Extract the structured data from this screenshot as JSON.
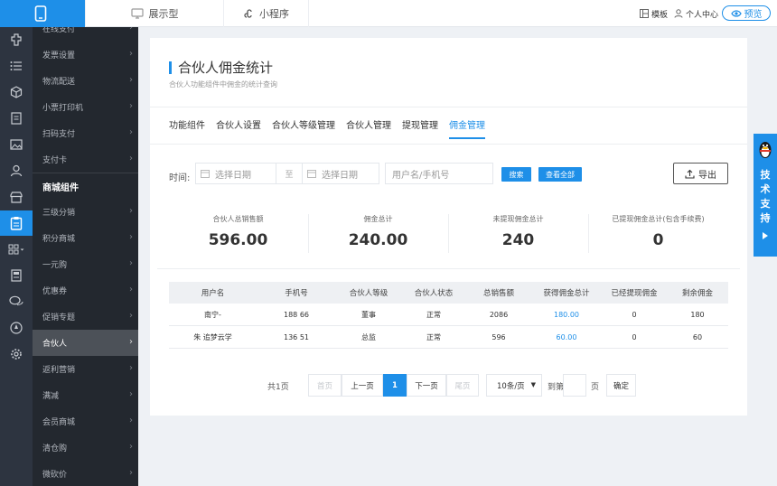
{
  "topbar": {
    "tab_show": "展示型",
    "tab_mini": "小程序",
    "template": "模板",
    "user_center": "个人中心",
    "preview": "预览"
  },
  "rail_icons": [
    "puzzle-icon",
    "list-icon",
    "cube-icon",
    "document-icon",
    "image-icon",
    "user-icon",
    "shop-icon",
    "clipboard-icon",
    "grid-icon",
    "report-icon",
    "chat-icon",
    "compass-icon",
    "gear-icon"
  ],
  "sidebar": {
    "items": [
      {
        "label": "在线支付",
        "group": false,
        "active": false
      },
      {
        "label": "发票设置",
        "group": false,
        "active": false
      },
      {
        "label": "物流配送",
        "group": false,
        "active": false
      },
      {
        "label": "小票打印机",
        "group": false,
        "active": false
      },
      {
        "label": "扫码支付",
        "group": false,
        "active": false
      },
      {
        "label": "支付卡",
        "group": false,
        "active": false
      },
      {
        "label": "商城组件",
        "group": true,
        "active": false
      },
      {
        "label": "三级分销",
        "group": false,
        "active": false
      },
      {
        "label": "积分商城",
        "group": false,
        "active": false
      },
      {
        "label": "一元购",
        "group": false,
        "active": false
      },
      {
        "label": "优惠券",
        "group": false,
        "active": false
      },
      {
        "label": "促销专题",
        "group": false,
        "active": false
      },
      {
        "label": "合伙人",
        "group": false,
        "active": true
      },
      {
        "label": "返利营销",
        "group": false,
        "active": false
      },
      {
        "label": "满减",
        "group": false,
        "active": false
      },
      {
        "label": "会员商城",
        "group": false,
        "active": false
      },
      {
        "label": "清仓购",
        "group": false,
        "active": false
      },
      {
        "label": "微砍价",
        "group": false,
        "active": false
      }
    ]
  },
  "page": {
    "title": "合伙人佣金统计",
    "subtitle": "合伙人功能组件中佣金的统计查询"
  },
  "tabs": [
    {
      "label": "功能组件",
      "active": false
    },
    {
      "label": "合伙人设置",
      "active": false
    },
    {
      "label": "合伙人等级管理",
      "active": false
    },
    {
      "label": "合伙人管理",
      "active": false
    },
    {
      "label": "提现管理",
      "active": false
    },
    {
      "label": "佣金管理",
      "active": true
    }
  ],
  "filters": {
    "time_label": "时间:",
    "start_placeholder": "选择日期",
    "separator": "至",
    "end_placeholder": "选择日期",
    "search_placeholder": "用户名/手机号",
    "search_button": "搜索",
    "view_all_button": "查看全部",
    "export_button": "导出"
  },
  "stats": [
    {
      "label": "合伙人总销售额",
      "value": "596.00"
    },
    {
      "label": "佣金总计",
      "value": "240.00"
    },
    {
      "label": "未提现佣金总计",
      "value": "240"
    },
    {
      "label": "已提现佣金总计(包含手续费)",
      "value": "0"
    }
  ],
  "table": {
    "headers": [
      "用户名",
      "手机号",
      "合伙人等级",
      "合伙人状态",
      "总销售额",
      "获得佣金总计",
      "已经提现佣金",
      "剩余佣金"
    ],
    "rows": [
      [
        "南宁-",
        "188        66",
        "董事",
        "正常",
        "2086",
        "180.00",
        "0",
        "180"
      ],
      [
        "朱        追梦云学",
        "136        51",
        "总监",
        "正常",
        "596",
        "60.00",
        "0",
        "60"
      ]
    ]
  },
  "pagination": {
    "total": "共1页",
    "first": "首页",
    "prev": "上一页",
    "current": "1",
    "next": "下一页",
    "last": "尾页",
    "page_size": "10条/页",
    "goto_label": "到第",
    "page_label": "页",
    "confirm": "确定"
  },
  "support": {
    "label": "技术支持"
  },
  "colors": {
    "accent": "#1e8fe8",
    "sidebar_bg": "#23282f",
    "rail_bg": "#2d3440",
    "active_menu": "#4c5158",
    "page_bg": "#eef1f5"
  }
}
